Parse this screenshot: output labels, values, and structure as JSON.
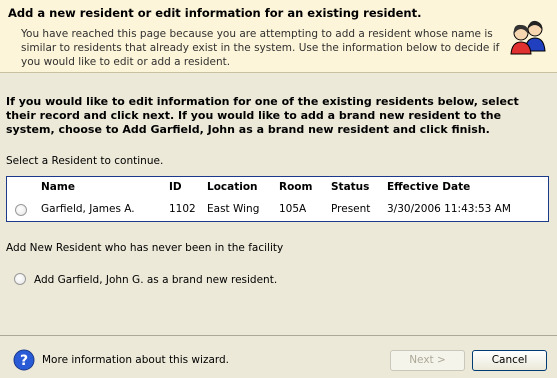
{
  "header": {
    "title": "Add a new resident or edit information for an existing resident.",
    "description": "You have reached this page because you are attempting to add a resident whose name is similar to residents that already exist in the system. Use the information below to decide if you would like to edit or add a resident.",
    "icon": "people-icon"
  },
  "main": {
    "instructions": "If you would like to edit information for one of the existing residents below, select their record and click next. If you would like to add a brand new resident to the system, choose to Add Garfield, John as a brand new resident and click finish.",
    "select_label": "Select a Resident to continue.",
    "table": {
      "columns": [
        "Name",
        "ID",
        "Location",
        "Room",
        "Status",
        "Effective Date"
      ],
      "rows": [
        {
          "name": "Garfield, James A.",
          "id": "1102",
          "location": "East Wing",
          "room": "105A",
          "status": "Present",
          "effective_date": "3/30/2006 11:43:53 AM",
          "selected": false
        }
      ]
    },
    "add_new_label": "Add New Resident who has never been in the facility",
    "add_new_option": "Add Garfield, John G. as a brand new resident."
  },
  "footer": {
    "more_info": "More information about this wizard.",
    "next_label": "Next >",
    "cancel_label": "Cancel",
    "next_enabled": false
  }
}
